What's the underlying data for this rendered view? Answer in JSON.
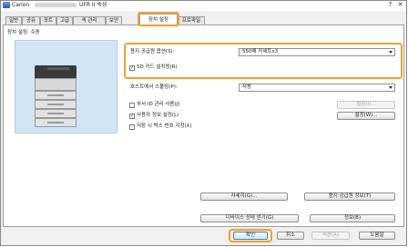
{
  "window": {
    "title_app": "Canon",
    "title_suffix": "UFR II 속성",
    "close_glyph": "✕",
    "help_glyph": "?"
  },
  "tabs": [
    {
      "label": "일반"
    },
    {
      "label": "공유"
    },
    {
      "label": "포트"
    },
    {
      "label": "고급"
    },
    {
      "label": "색 관리"
    },
    {
      "label": "보안"
    },
    {
      "label": "장치 설정"
    },
    {
      "label": "프로파일"
    }
  ],
  "active_tab": "장치 설정",
  "page": {
    "heading": "장치 설정: 수동"
  },
  "paper_source": {
    "label": "용지 공급원 옵션(S):",
    "value": "550매 카세트x3"
  },
  "sd_card": {
    "label": "SD 카드 설치됨(R)",
    "checked": true,
    "mark": "✓"
  },
  "host_spooling": {
    "label": "호스트에서 스풀링(P):",
    "value": "자동"
  },
  "dept_id": {
    "label": "부서 ID 관리 사용(J)",
    "checked": false,
    "button": "설정(I)..."
  },
  "user_info": {
    "label": "사용자 정보 설정(L)",
    "checked": true,
    "mark": "✓",
    "button": "설정(W)..."
  },
  "storage_box": {
    "label": "저장 시 박스 번호 지정(X)",
    "checked": false
  },
  "buttons": {
    "details": "자세히(G)...",
    "paper_source_info": "용지 공급원 정보(T)",
    "get_device_status": "디바이스 상태 얻기(G)",
    "info": "정보(B)",
    "ok": "확인",
    "cancel": "취소",
    "apply": "적용(A)",
    "help": "도움말"
  },
  "colors": {
    "highlight": "#f0a030",
    "printer_bg": "#d3e4f5"
  }
}
